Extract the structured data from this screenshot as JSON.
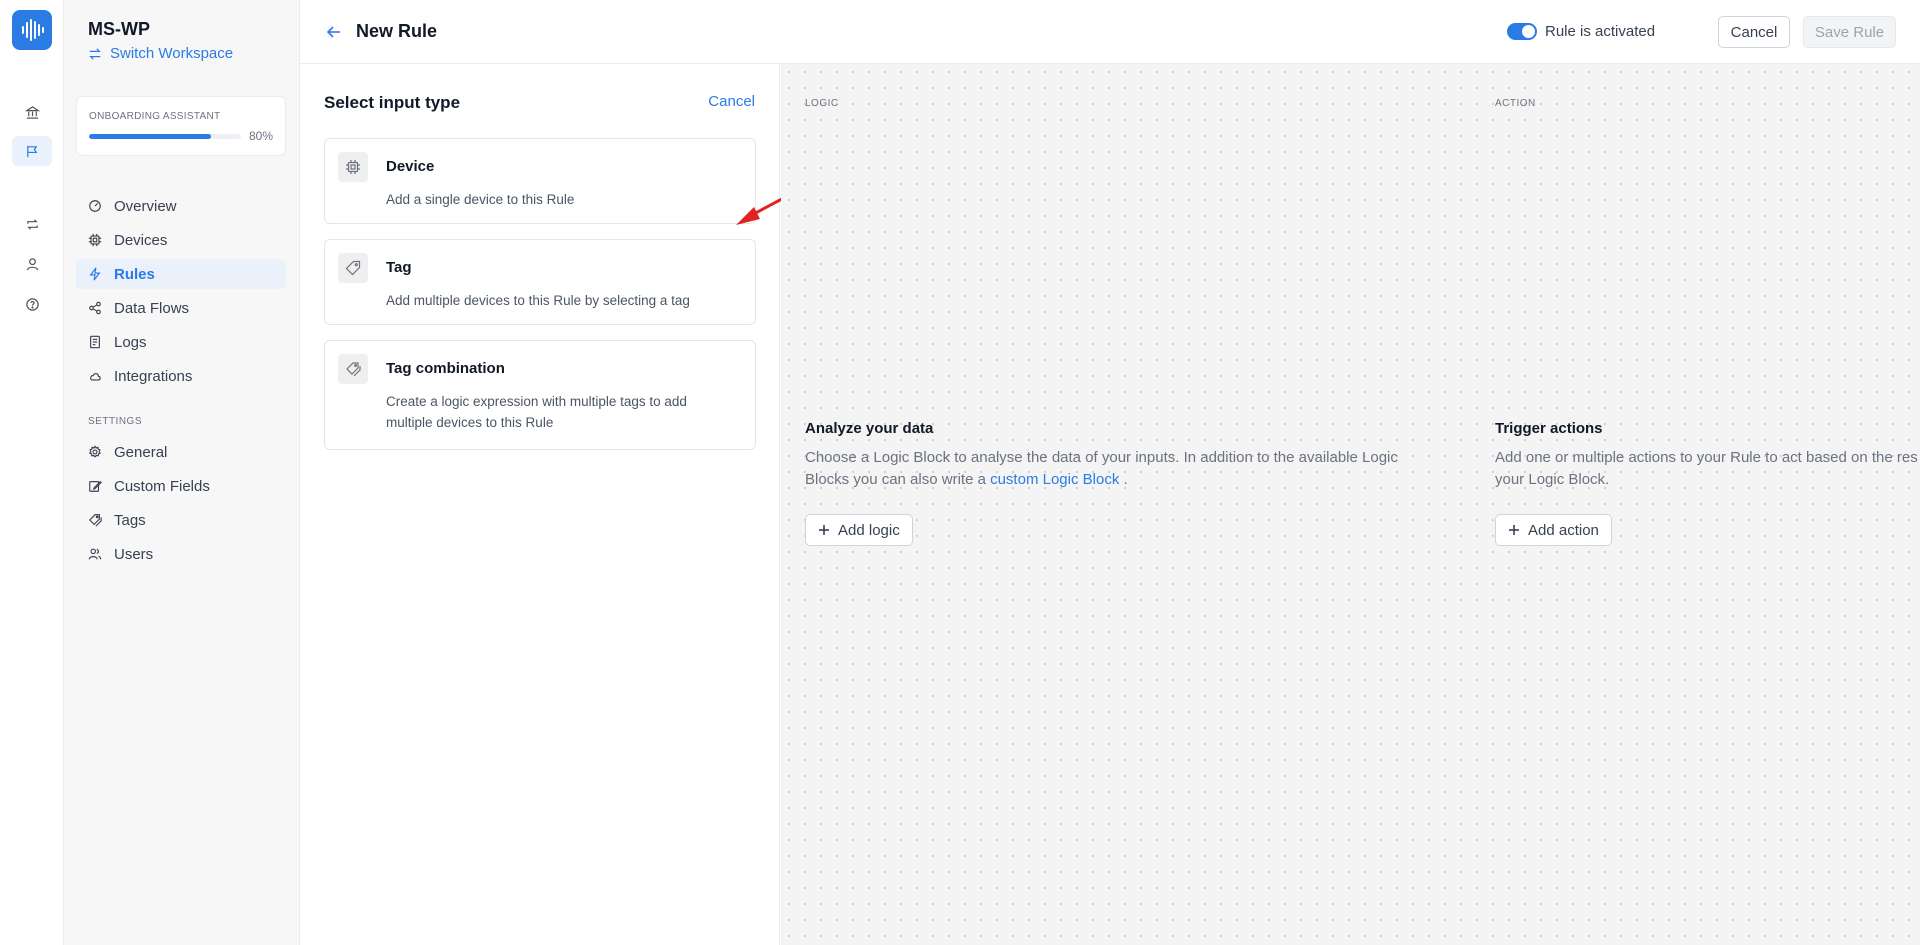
{
  "workspace": {
    "name": "MS-WP",
    "switch_label": "Switch Workspace"
  },
  "onboarding": {
    "label": "ONBOARDING ASSISTANT",
    "progress_percent": 80,
    "progress_text": "80%"
  },
  "nav": {
    "items": [
      {
        "label": "Overview",
        "icon": "dashboard-icon"
      },
      {
        "label": "Devices",
        "icon": "chip-icon"
      },
      {
        "label": "Rules",
        "icon": "lightning-icon",
        "active": true
      },
      {
        "label": "Data Flows",
        "icon": "share-icon"
      },
      {
        "label": "Logs",
        "icon": "log-icon"
      },
      {
        "label": "Integrations",
        "icon": "cloud-icon"
      }
    ],
    "settings_label": "SETTINGS",
    "settings_items": [
      {
        "label": "General",
        "icon": "gear-icon"
      },
      {
        "label": "Custom Fields",
        "icon": "edit-icon"
      },
      {
        "label": "Tags",
        "icon": "tags-icon"
      },
      {
        "label": "Users",
        "icon": "users-icon"
      }
    ]
  },
  "header": {
    "title": "New Rule",
    "toggle_label": "Rule is activated",
    "rule_activated": true,
    "cancel_label": "Cancel",
    "save_label": "Save Rule"
  },
  "input_panel": {
    "title": "Select input type",
    "cancel_label": "Cancel",
    "options": [
      {
        "title": "Device",
        "description": "Add a single device to this Rule",
        "icon": "chip-icon"
      },
      {
        "title": "Tag",
        "description": "Add multiple devices to this Rule by selecting a tag",
        "icon": "tag-icon"
      },
      {
        "title": "Tag combination",
        "description": "Create a logic expression with multiple tags to add multiple devices to this Rule",
        "icon": "tags-icon"
      }
    ]
  },
  "canvas": {
    "logic": {
      "label": "LOGIC",
      "title": "Analyze your data",
      "desc_line1": "Choose a Logic Block to analyse the data of your inputs. In addition to the available Logic",
      "desc_line2_pre": "Blocks you can also write a ",
      "desc_link": "custom Logic Block",
      "desc_line2_post": " .",
      "button": "Add logic"
    },
    "action": {
      "label": "ACTION",
      "title": "Trigger actions",
      "desc_line1": "Add one or multiple actions to your Rule to act based on the res",
      "desc_line2": "your Logic Block.",
      "button": "Add action"
    }
  },
  "colors": {
    "accent": "#2b7be5",
    "annotation_arrow": "#e02424"
  }
}
